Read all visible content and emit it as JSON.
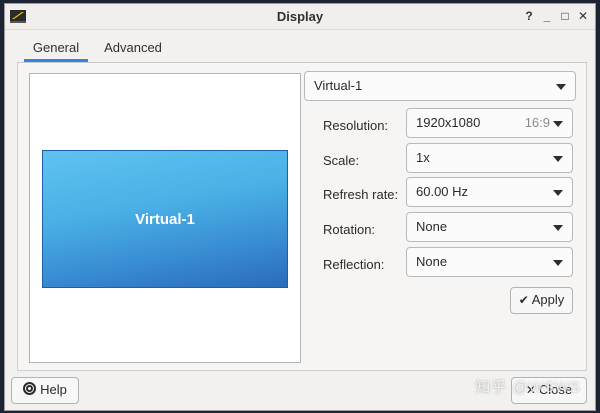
{
  "window": {
    "title": "Display",
    "controls": {
      "help": "?",
      "minimize": "_",
      "maximize": "□",
      "close": "✕"
    }
  },
  "tabs": [
    {
      "label": "General",
      "active": true
    },
    {
      "label": "Advanced",
      "active": false
    }
  ],
  "preview": {
    "monitor_label": "Virtual-1"
  },
  "output_select": {
    "value": "Virtual-1"
  },
  "settings": {
    "resolution": {
      "label": "Resolution:",
      "value": "1920x1080",
      "aspect": "16:9"
    },
    "scale": {
      "label": "Scale:",
      "value": "1x"
    },
    "refresh_rate": {
      "label": "Refresh rate:",
      "value": "60.00 Hz"
    },
    "rotation": {
      "label": "Rotation:",
      "value": "None"
    },
    "reflection": {
      "label": "Reflection:",
      "value": "None"
    }
  },
  "buttons": {
    "apply": "Apply",
    "help": "Help",
    "close": "Close"
  },
  "watermark": "知乎 @WSWS",
  "colors": {
    "accent": "#3584e4",
    "monitor": "#4ab1e6"
  }
}
